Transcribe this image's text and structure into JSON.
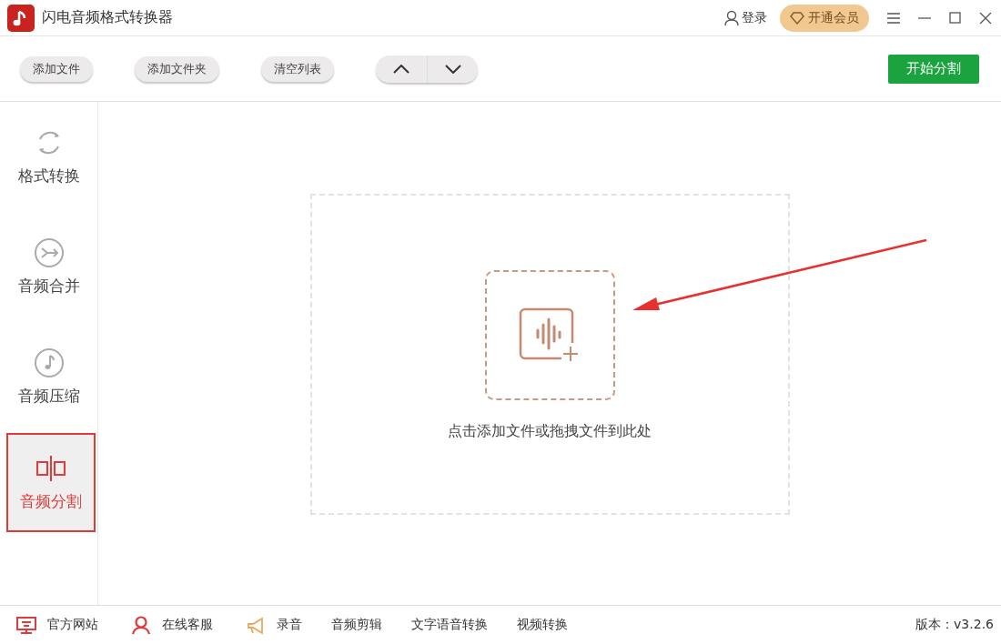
{
  "window": {
    "title": "闪电音频格式转换器"
  },
  "header": {
    "login": "登录",
    "vip": "开通会员"
  },
  "toolbar": {
    "buttons": [
      "添加文件",
      "添加文件夹",
      "清空列表"
    ],
    "start": "开始分割"
  },
  "sidebar": {
    "items": [
      {
        "kind": "convert",
        "label": "格式转换",
        "selected": false
      },
      {
        "kind": "merge",
        "label": "音频合并",
        "selected": false
      },
      {
        "kind": "compress",
        "label": "音频压缩",
        "selected": false
      },
      {
        "kind": "split",
        "label": "音频分割",
        "selected": true
      }
    ]
  },
  "dropzone": {
    "hint": "点击添加文件或拖拽文件到此处"
  },
  "footer": {
    "links": [
      {
        "kind": "monitor",
        "label": "官方网站"
      },
      {
        "kind": "person",
        "label": "在线客服"
      },
      {
        "kind": "megaphone",
        "label": "录音"
      },
      {
        "kind": "plain",
        "label": "音频剪辑"
      },
      {
        "kind": "plain",
        "label": "文字语音转换"
      },
      {
        "kind": "plain",
        "label": "视频转换"
      }
    ],
    "version": "版本：v3.2.6"
  }
}
